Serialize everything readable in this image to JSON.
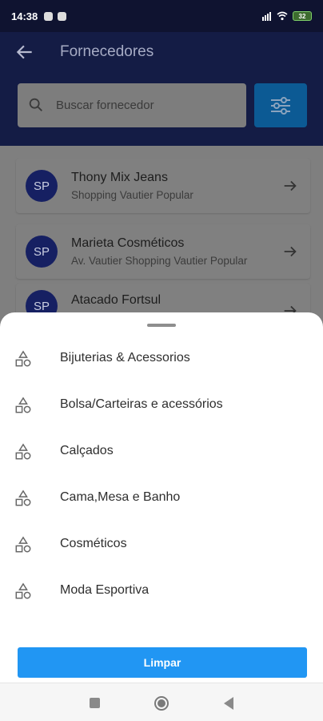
{
  "status_bar": {
    "time": "14:38",
    "battery": "32"
  },
  "header": {
    "title": "Fornecedores"
  },
  "search": {
    "placeholder": "Buscar fornecedor",
    "value": ""
  },
  "suppliers": [
    {
      "initials": "SP",
      "name": "Thony Mix Jeans",
      "address": "Shopping Vautier Popular"
    },
    {
      "initials": "SP",
      "name": "Marieta Cosméticos",
      "address": "Av. Vautier  Shopping Vautier Popular"
    },
    {
      "initials": "SP",
      "name": "Atacado Fortsul",
      "address": ""
    }
  ],
  "categories": [
    "Bijuterias & Acessorios",
    "Bolsa/Carteiras e acessórios",
    "Calçados",
    "Cama,Mesa e Banho",
    "Cosméticos",
    "Moda Esportiva"
  ],
  "actions": {
    "clear_label": "Limpar"
  },
  "colors": {
    "header": "#141c45",
    "accent": "#2196f3",
    "avatar": "#162062"
  }
}
